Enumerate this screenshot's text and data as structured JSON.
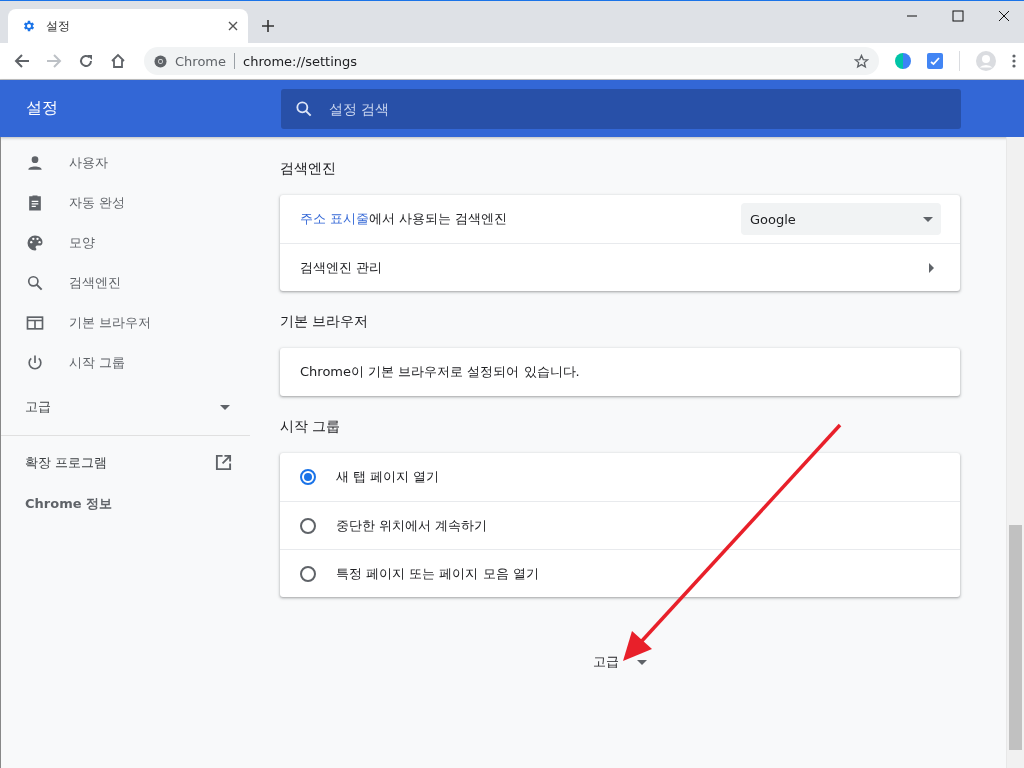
{
  "browser": {
    "tab_title": "설정",
    "site_label": "Chrome",
    "url": "chrome://settings"
  },
  "header": {
    "title": "설정",
    "search_placeholder": "설정 검색"
  },
  "sidebar": {
    "items": [
      {
        "label": "사용자"
      },
      {
        "label": "자동 완성"
      },
      {
        "label": "모양"
      },
      {
        "label": "검색엔진"
      },
      {
        "label": "기본 브라우저"
      },
      {
        "label": "시작 그룹"
      }
    ],
    "advanced": {
      "label": "고급",
      "expanded": false
    },
    "links": [
      {
        "label": "확장 프로그램",
        "external": true
      },
      {
        "label": "Chrome 정보",
        "external": false
      }
    ]
  },
  "sections": [
    {
      "heading": "검색엔진",
      "rows": [
        {
          "kind": "dropdown",
          "link": "주소 표시줄",
          "text": "에서 사용되는 검색엔진",
          "value": "Google"
        },
        {
          "kind": "nav",
          "label": "검색엔진 관리"
        }
      ]
    },
    {
      "heading": "기본 브라우저",
      "rows": [
        {
          "kind": "text",
          "label": "Chrome이 기본 브라우저로 설정되어 있습니다."
        }
      ]
    },
    {
      "heading": "시작 그룹",
      "rows": [
        {
          "kind": "radio",
          "label": "새 탭 페이지 열기",
          "selected": true
        },
        {
          "kind": "radio",
          "label": "중단한 위치에서 계속하기",
          "selected": false
        },
        {
          "kind": "radio",
          "label": "특정 페이지 또는 페이지 모음 열기",
          "selected": false
        }
      ]
    }
  ],
  "advanced_toggle": {
    "label": "고급",
    "expanded": false
  }
}
